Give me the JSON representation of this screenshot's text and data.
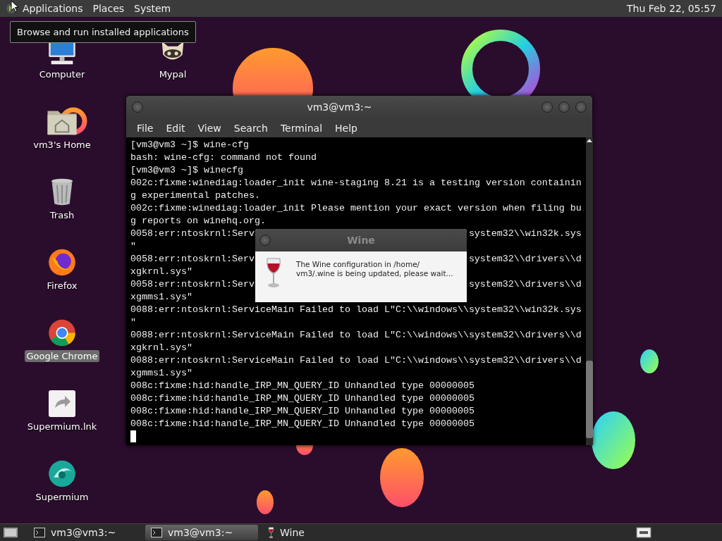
{
  "top_panel": {
    "menus": [
      "Applications",
      "Places",
      "System"
    ],
    "clock": "Thu Feb 22, 05:57"
  },
  "tooltip": "Browse and run installed applications",
  "desktop_icons": [
    {
      "label": "Computer",
      "kind": "computer",
      "selected": false
    },
    {
      "label": "Mypal",
      "kind": "mypal",
      "selected": false
    },
    {
      "label": "vm3's Home",
      "kind": "home",
      "selected": false
    },
    {
      "label": "Trash",
      "kind": "trash",
      "selected": false
    },
    {
      "label": "Firefox",
      "kind": "firefox",
      "selected": false
    },
    {
      "label": "Google Chrome",
      "kind": "chrome",
      "selected": true
    },
    {
      "label": "Supermium.lnk",
      "kind": "link",
      "selected": false
    },
    {
      "label": "Supermium",
      "kind": "supermium",
      "selected": false
    }
  ],
  "terminal": {
    "title": "vm3@vm3:~",
    "menu": [
      "File",
      "Edit",
      "View",
      "Search",
      "Terminal",
      "Help"
    ],
    "lines": [
      {
        "text": "[vm3@vm3 ~]$ wine-cfg"
      },
      {
        "text": "bash: wine-cfg: command not found"
      },
      {
        "text": "[vm3@vm3 ~]$ winecfg"
      },
      {
        "text": "002c:fixme:winediag:loader_init wine-staging 8.21 is a testing version containin"
      },
      {
        "text": "g experimental patches."
      },
      {
        "text": "002c:fixme:winediag:loader_init Please mention your exact version when filing bu"
      },
      {
        "text": "g reports on winehq.org."
      },
      {
        "left": "0058:err:ntoskrnl:Serv",
        "right": "system32\\\\win32k.sys"
      },
      {
        "text": "\""
      },
      {
        "left": "0058:err:ntoskrnl:Serv",
        "right": "system32\\\\drivers\\\\d"
      },
      {
        "text": "xgkrnl.sys\""
      },
      {
        "left": "0058:err:ntoskrnl:Serv",
        "right": "system32\\\\drivers\\\\d"
      },
      {
        "text": "xgmms1.sys\""
      },
      {
        "text": "0088:err:ntoskrnl:ServiceMain Failed to load L\"C:\\\\windows\\\\system32\\\\win32k.sys"
      },
      {
        "text": "\""
      },
      {
        "text": "0088:err:ntoskrnl:ServiceMain Failed to load L\"C:\\\\windows\\\\system32\\\\drivers\\\\d"
      },
      {
        "text": "xgkrnl.sys\""
      },
      {
        "text": "0088:err:ntoskrnl:ServiceMain Failed to load L\"C:\\\\windows\\\\system32\\\\drivers\\\\d"
      },
      {
        "text": "xgmms1.sys\""
      },
      {
        "text": "008c:fixme:hid:handle_IRP_MN_QUERY_ID Unhandled type 00000005"
      },
      {
        "text": "008c:fixme:hid:handle_IRP_MN_QUERY_ID Unhandled type 00000005"
      },
      {
        "text": "008c:fixme:hid:handle_IRP_MN_QUERY_ID Unhandled type 00000005"
      },
      {
        "text": "008c:fixme:hid:handle_IRP_MN_QUERY_ID Unhandled type 00000005"
      }
    ]
  },
  "dialog": {
    "title": "Wine",
    "message": "The Wine configuration in /home/\nvm3/.wine is being updated, please wait..."
  },
  "taskbar": {
    "items": [
      {
        "label": "vm3@vm3:~",
        "kind": "terminal",
        "selected": false
      },
      {
        "label": "vm3@vm3:~",
        "kind": "terminal",
        "selected": true
      },
      {
        "label": "Wine",
        "kind": "wine",
        "selected": false
      }
    ]
  }
}
